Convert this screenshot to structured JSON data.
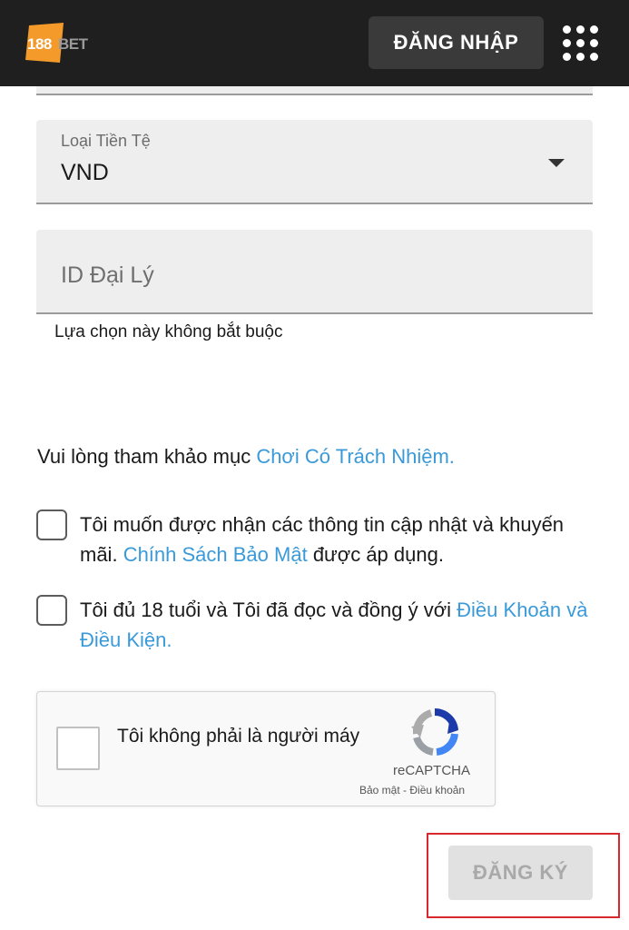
{
  "header": {
    "logo_text": "188BET",
    "login_label": "ĐĂNG NHẬP",
    "menu_icon": "grid-menu-icon",
    "logo_color": "#f39a2b"
  },
  "currency": {
    "label": "Loại Tiền Tệ",
    "value": "VND",
    "icon": "caret-down-icon"
  },
  "agent_id": {
    "placeholder": "ID Đại Lý",
    "value": "",
    "helper": "Lựa chọn này không bắt buộc"
  },
  "responsible": {
    "prefix": "Vui lòng tham khảo mục ",
    "link": "Chơi Có Trách Nhiệm."
  },
  "consents": {
    "marketing": {
      "checked": false,
      "text_before": "Tôi muốn được nhận các thông tin cập nhật và khuyến mãi. ",
      "link": "Chính Sách Bảo Mật",
      "text_after": " được áp dụng."
    },
    "terms": {
      "checked": false,
      "text_before": "Tôi đủ 18 tuổi và Tôi đã đọc và đồng ý với ",
      "link": "Điều Khoản và Điều Kiện."
    }
  },
  "captcha": {
    "checked": false,
    "label": "Tôi không phải là người máy",
    "brand": "reCAPTCHA",
    "privacy": "Bảo mật",
    "separator": " - ",
    "terms": "Điều khoản"
  },
  "register": {
    "label": "ĐĂNG KÝ",
    "disabled": true
  },
  "colors": {
    "header_bg": "#1f1f1f",
    "link": "#3a9ad9",
    "highlight": "#d9272e"
  }
}
